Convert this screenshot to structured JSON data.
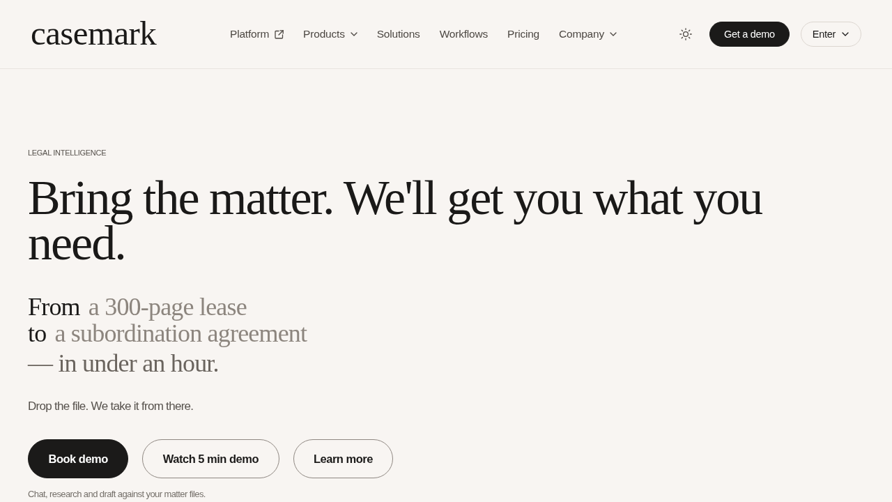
{
  "header": {
    "logo": "casemark",
    "nav": [
      {
        "label": "Platform",
        "kind": "external"
      },
      {
        "label": "Products",
        "kind": "dropdown"
      },
      {
        "label": "Solutions",
        "kind": "link"
      },
      {
        "label": "Workflows",
        "kind": "link"
      },
      {
        "label": "Pricing",
        "kind": "link"
      },
      {
        "label": "Company",
        "kind": "dropdown"
      }
    ],
    "actions": [
      {
        "label": "Get a demo",
        "kind": "primary"
      },
      {
        "label": "Enter",
        "kind": "dropdown"
      }
    ]
  },
  "hero": {
    "eyebrow": "LEGAL INTELLIGENCE",
    "headline": "Bring the matter. We'll get you what you need.",
    "lines": [
      {
        "lead": "From",
        "example": "a 300-page lease"
      },
      {
        "lead": "to",
        "example": "a subordination agreement"
      }
    ],
    "closing": "— in under an hour.",
    "tagline": "Drop the file. We take it from there.",
    "buttons": [
      {
        "label": "Book demo",
        "kind": "primary"
      },
      {
        "label": "Watch 5 min demo",
        "kind": "outline"
      },
      {
        "label": "Learn more",
        "kind": "outline"
      }
    ],
    "caption": "Chat, research and draft against your matter files."
  }
}
